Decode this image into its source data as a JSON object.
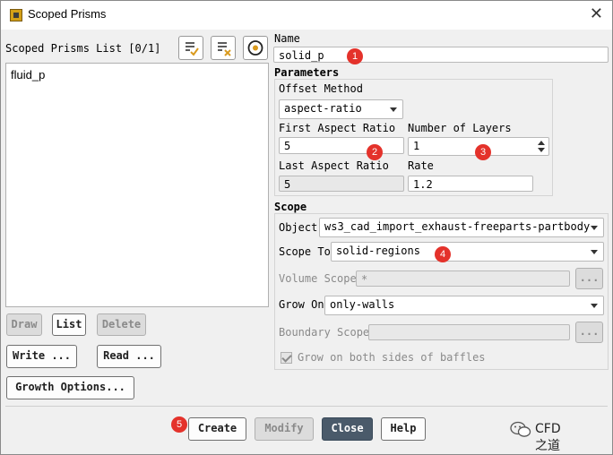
{
  "window": {
    "title": "Scoped Prisms"
  },
  "list": {
    "header": "Scoped Prisms List [0/1]",
    "items": [
      "fluid_p"
    ]
  },
  "name": {
    "label": "Name",
    "value": "solid_p"
  },
  "parameters": {
    "title": "Parameters",
    "offset_method_label": "Offset Method",
    "offset_method_value": "aspect-ratio",
    "first_aspect_ratio_label": "First Aspect Ratio",
    "first_aspect_ratio_value": "5",
    "number_of_layers_label": "Number of Layers",
    "number_of_layers_value": "1",
    "last_aspect_ratio_label": "Last Aspect Ratio",
    "last_aspect_ratio_value": "5",
    "rate_label": "Rate",
    "rate_value": "1.2"
  },
  "scope": {
    "title": "Scope",
    "object_label": "Object",
    "object_value": "ws3_cad_import_exhaust-freeparts-partbody",
    "scope_to_label": "Scope To",
    "scope_to_value": "solid-regions",
    "volume_scope_label": "Volume Scope",
    "volume_scope_value": "*",
    "grow_on_label": "Grow On",
    "grow_on_value": "only-walls",
    "boundary_scope_label": "Boundary Scope",
    "boundary_scope_value": "",
    "ellipsis": "...",
    "grow_both_sides_label": "Grow on both sides of baffles"
  },
  "left_buttons": {
    "draw": "Draw",
    "list": "List",
    "delete": "Delete",
    "write": "Write ...",
    "read": "Read ...",
    "growth_options": "Growth Options..."
  },
  "bottom_buttons": {
    "create": "Create",
    "modify": "Modify",
    "close": "Close",
    "help": "Help"
  },
  "badges": [
    "1",
    "2",
    "3",
    "4",
    "5"
  ],
  "watermark": {
    "text": "CFD之道",
    "icon": "wechat-icon"
  },
  "colors": {
    "badge": "#e4322b",
    "close_button": "#4a5a6a",
    "dialog_bg": "#f0f0f0"
  }
}
